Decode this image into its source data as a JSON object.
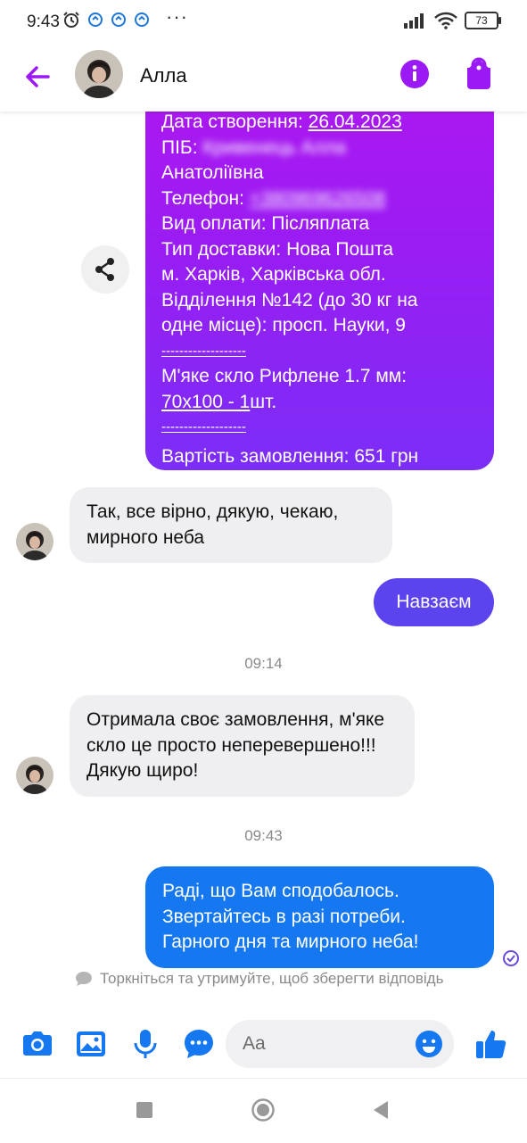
{
  "status_bar": {
    "time": "9:43",
    "battery": "73",
    "icons": [
      "alarm-icon",
      "sync-icon",
      "sync-icon",
      "sync-icon",
      "more-dots-icon",
      "signal-icon",
      "wifi-icon",
      "battery-icon"
    ]
  },
  "header": {
    "contact_name": "Алла",
    "accent": "#9b19f5"
  },
  "order_message": {
    "lines": [
      {
        "prefix": "Дата створення: ",
        "value": "26.04.2023"
      },
      {
        "prefix": "ПІБ: ",
        "value": "Кривенець Алла"
      },
      {
        "prefix": "",
        "value": "Анатоліївна"
      },
      {
        "prefix": "Телефон: ",
        "value": "+380969626508"
      },
      {
        "prefix": "Вид оплати: ",
        "value": "Післяплата"
      },
      {
        "prefix": "",
        "value": "Тип доставки: Нова Пошта"
      },
      {
        "prefix": "",
        "value": "м. Харків, Харківська обл."
      },
      {
        "prefix": "",
        "value": "Відділення №142 (до 30 кг на"
      },
      {
        "prefix": "",
        "value": "одне місце): просп. Науки, 9"
      },
      {
        "prefix": "",
        "value": "-------------------"
      },
      {
        "prefix": "",
        "value": "М'яке скло Рифлене 1.7 мм:"
      },
      {
        "prefix": "",
        "value": "70х100 - 1"
      },
      {
        "prefix": "",
        "value": "шт."
      },
      {
        "prefix": "",
        "value": "-------------------"
      },
      {
        "prefix": "",
        "value": "Вартість замовлення: 651 грн"
      }
    ]
  },
  "messages": [
    {
      "from": "contact",
      "text": "Так, все вірно, дякую, чекаю, мирного неба"
    },
    {
      "from": "me",
      "text": "Навзаєм"
    },
    {
      "type": "timestamp",
      "text": "09:14"
    },
    {
      "from": "contact",
      "text": "Отримала своє замовлення, м'яке скло це просто неперевершено!!! Дякую щиро!"
    },
    {
      "type": "timestamp",
      "text": "09:43"
    },
    {
      "from": "me",
      "text": "Раді, що Вам сподобалось. Звертайтесь в разі потреби. Гарного дня та мирного неба!"
    }
  ],
  "hint": "Торкніться та утримуйте, щоб зберегти відповідь",
  "composer": {
    "placeholder": "Aa",
    "icons": [
      "camera-icon",
      "image-icon",
      "microphone-icon",
      "chat-bubble-icon",
      "emoji-icon",
      "like-icon"
    ]
  },
  "colors": {
    "bubble_gradient_top": "#b017f0",
    "bubble_gradient_bottom": "#7b2ef6",
    "reply_purple": "#5b43ee",
    "reply_blue": "#1678f1",
    "composer_icons": "#1678f1"
  }
}
